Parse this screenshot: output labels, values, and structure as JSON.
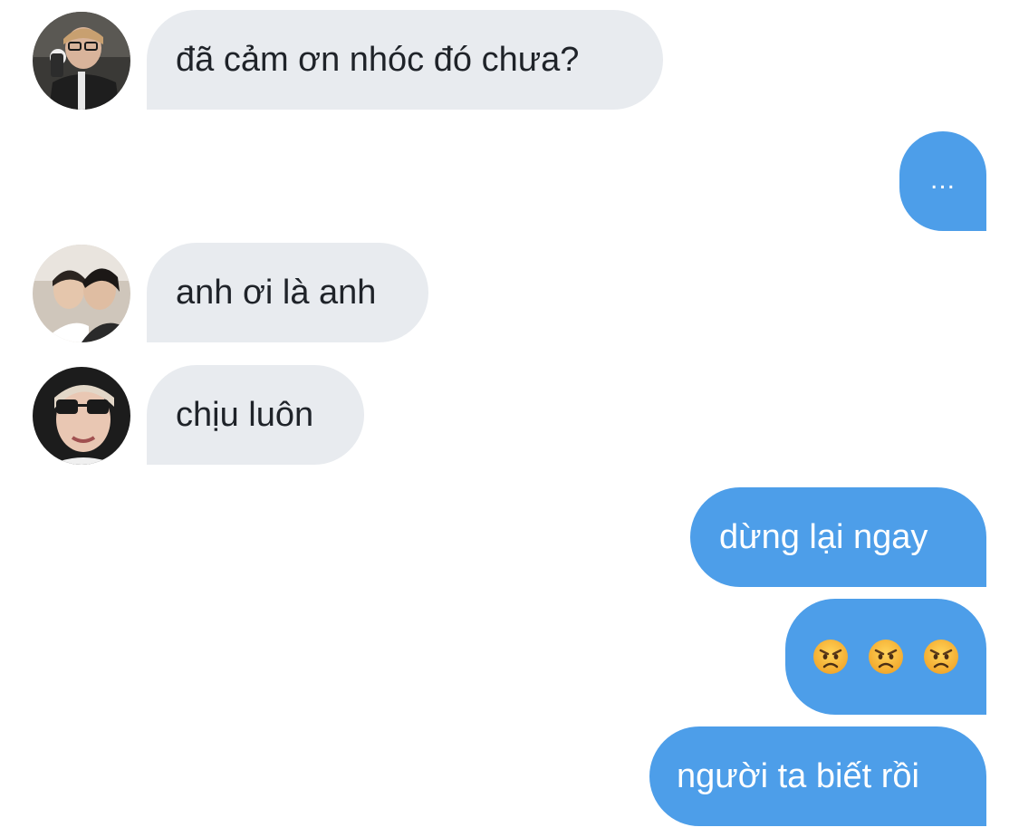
{
  "messages": [
    {
      "direction": "incoming",
      "text": "đã cảm ơn nhóc đó chưa?",
      "avatar_icon": "avatar-glasses-selfie-icon"
    },
    {
      "direction": "outgoing",
      "text": "..."
    },
    {
      "direction": "incoming",
      "text": "anh ơi là anh",
      "avatar_icon": "avatar-two-people-icon"
    },
    {
      "direction": "incoming",
      "text": "chịu luôn",
      "avatar_icon": "avatar-sunglasses-icon"
    },
    {
      "direction": "outgoing",
      "text": "dừng lại ngay"
    },
    {
      "direction": "outgoing",
      "emoji": [
        "angry-face-icon",
        "angry-face-icon",
        "angry-face-icon"
      ]
    },
    {
      "direction": "outgoing",
      "text": "người ta biết rồi"
    }
  ],
  "colors": {
    "incoming_bubble": "#e8ebef",
    "outgoing_bubble": "#4d9ee9",
    "incoming_text": "#1f2329",
    "outgoing_text": "#ffffff"
  }
}
